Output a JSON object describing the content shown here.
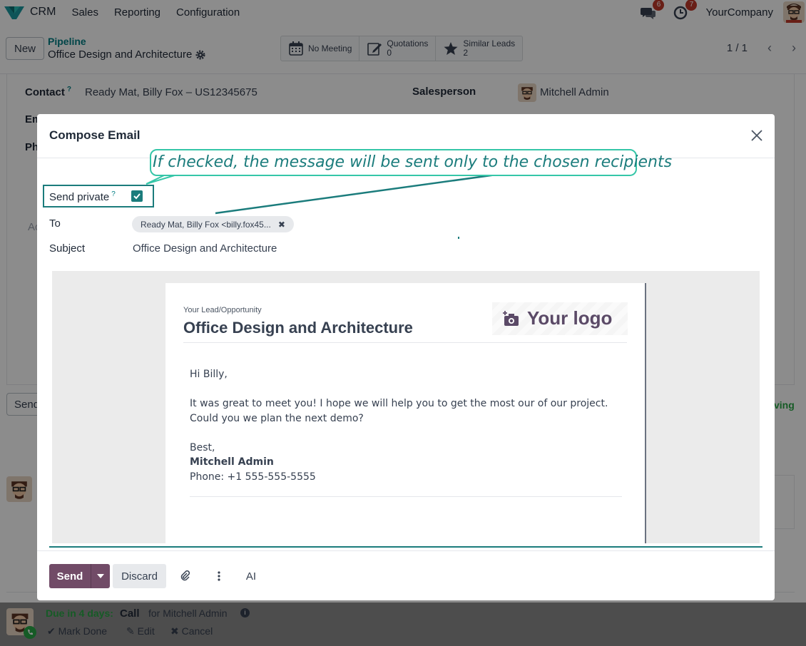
{
  "navbar": {
    "app_name": "CRM",
    "menu": [
      "Sales",
      "Reporting",
      "Configuration"
    ],
    "messages_badge": "6",
    "activities_badge": "7",
    "company": "YourCompany"
  },
  "control_panel": {
    "new_label": "New",
    "breadcrumb_parent": "Pipeline",
    "breadcrumb_current": "Office Design and Architecture",
    "smart_buttons": {
      "meeting": "No Meeting",
      "quotations_label": "Quotations",
      "quotations_count": "0",
      "similar_label": "Similar Leads",
      "similar_count": "2"
    },
    "pager": "1 / 1"
  },
  "background_form": {
    "contact_label": "Contact",
    "contact_help": "?",
    "contact_value": "Ready Mat, Billy Fox – US12345675",
    "salesperson_label": "Salesperson",
    "salesperson_value": "Mitchell Admin",
    "email_label_partial": "Em",
    "phone_label_partial": "Ph",
    "send_button_partial": "Send",
    "note_partial": "Ac",
    "right_text_partial": "ving"
  },
  "chatter": {
    "due": "Due in 4 days:",
    "activity_type": "Call",
    "for_user": "for Mitchell Admin",
    "mark_done": "Mark Done",
    "edit": "Edit",
    "cancel": "Cancel"
  },
  "modal": {
    "title": "Compose Email",
    "send_private_label": "Send private",
    "send_private_help": "?",
    "send_private_checked": true,
    "to_label": "To",
    "to_tag": "Ready Mat, Billy Fox <billy.fox45...",
    "subject_label": "Subject",
    "subject_value": "Office Design and Architecture",
    "email": {
      "lead_label": "Your Lead/Opportunity",
      "lead_title": "Office Design and Architecture",
      "logo_text": "Your logo",
      "greeting": "Hi Billy,",
      "line1": "It was great to meet you! I hope we will help you to get the most our of our project.",
      "line2": "Could you we plan the next demo?",
      "closing": "Best,",
      "signature_name": "Mitchell Admin",
      "signature_phone": "Phone: +1 555-555-5555"
    },
    "buttons": {
      "send": "Send",
      "discard": "Discard",
      "ai": "AI"
    }
  },
  "annotation": {
    "callout_text": "If checked, the message will be sent only to the chosen recipients"
  },
  "colors": {
    "brand_primary": "#714b67",
    "accent_teal": "#017e84",
    "callout_border": "#35c6a8",
    "badge_red": "#c0392b"
  }
}
